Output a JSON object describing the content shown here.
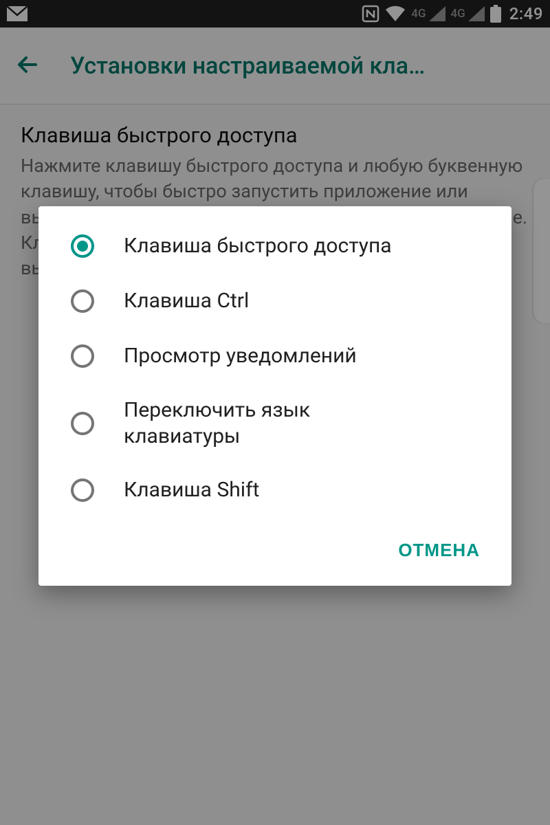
{
  "statusbar": {
    "clock": "2:49",
    "network_label": "4G"
  },
  "appbar": {
    "title": "Установки настраиваемой кла…"
  },
  "section": {
    "title": "Клавиша быстрого доступа",
    "description": "Нажмите клавишу быстрого доступа и любую буквенную клавишу, чтобы быстро запустить приложение или выполнить действие при нахождении на главном экране. Клавишу можно дополнительно настроить и на выполнение других действий."
  },
  "dialog": {
    "options": [
      {
        "label": "Клавиша быстрого доступа",
        "selected": true
      },
      {
        "label": "Клавиша Ctrl",
        "selected": false
      },
      {
        "label": "Просмотр уведомлений",
        "selected": false
      },
      {
        "label": "Переключить язык клавиатуры",
        "selected": false
      },
      {
        "label": "Клавиша Shift",
        "selected": false
      }
    ],
    "cancel": "ОТМЕНА"
  },
  "colors": {
    "accent": "#009688"
  }
}
